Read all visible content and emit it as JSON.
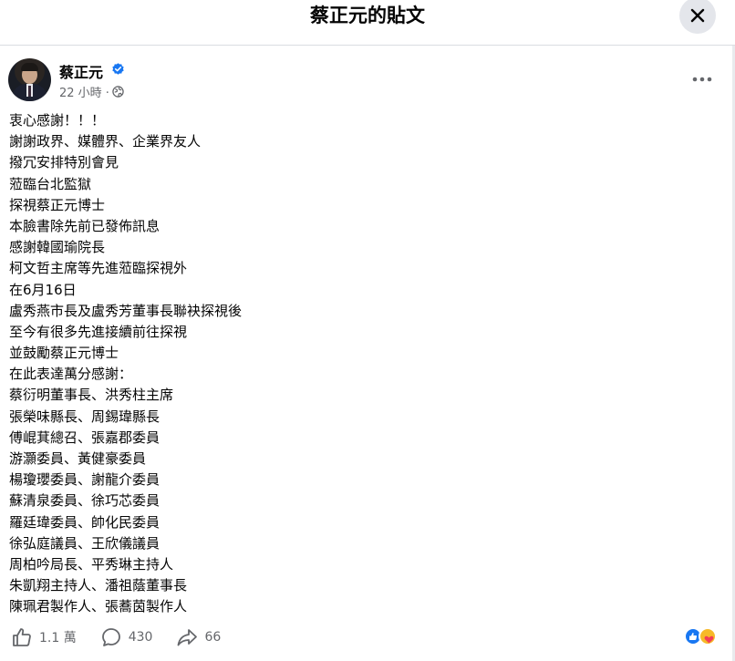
{
  "header": {
    "title": "蔡正元的貼文"
  },
  "post": {
    "author": "蔡正元",
    "time": "22 小時 ·",
    "lines": [
      "衷心感謝！！！",
      "謝謝政界、媒體界、企業界友人",
      "撥冗安排特別會見",
      "蒞臨台北監獄",
      "探視蔡正元博士",
      "本臉書除先前已發佈訊息",
      "感謝韓國瑜院長",
      "柯文哲主席等先進蒞臨探視外",
      "在6月16日",
      "盧秀燕市長及盧秀芳董事長聯袂探視後",
      "至今有很多先進接續前往探視",
      "並鼓勵蔡正元博士",
      "在此表達萬分感謝：",
      "蔡衍明董事長、洪秀柱主席",
      "張榮味縣長、周錫瑋縣長",
      "傅崐萁總召、張嘉郡委員",
      "游灝委員、黃健豪委員",
      "楊瓊瓔委員、謝龍介委員",
      "蘇清泉委員、徐巧芯委員",
      "羅廷瑋委員、帥化民委員",
      "徐弘庭議員、王欣儀議員",
      "周柏吟局長、平秀琳主持人",
      "朱凱翔主持人、潘祖蔭董事長",
      "陳珮君製作人、張蕎茵製作人"
    ]
  },
  "footer": {
    "likes": "1.1 萬",
    "comments": "430",
    "shares": "66"
  },
  "icons": {
    "close": "close-icon",
    "more": "more-icon",
    "verified": "verified-badge-icon",
    "globe": "globe-icon",
    "like": "like-icon",
    "comment": "comment-icon",
    "share": "share-icon",
    "reaction_like": "like-reaction-icon",
    "reaction_care": "care-reaction-icon"
  },
  "colors": {
    "accent": "#1877f2",
    "secondary_text": "#65676b",
    "care": "#f7b928"
  }
}
